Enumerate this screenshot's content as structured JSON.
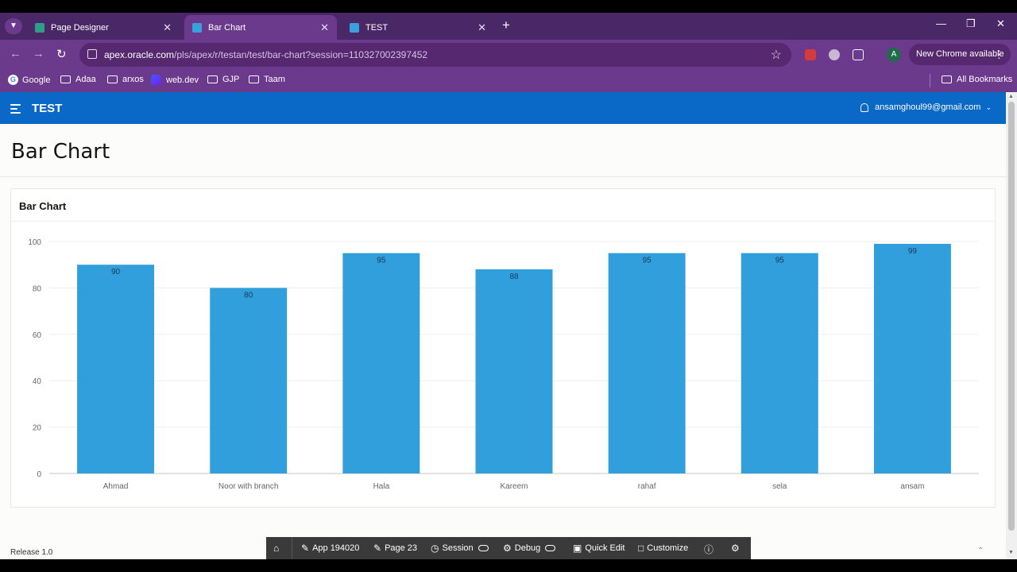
{
  "browser": {
    "tabs": [
      {
        "label": "Page Designer",
        "icon": "apex-designer-icon"
      },
      {
        "label": "Bar Chart",
        "icon": "apex-app-icon",
        "active": true
      },
      {
        "label": "TEST",
        "icon": "apex-app-icon"
      }
    ],
    "url_domain": "apex.oracle.com",
    "url_path": "/pls/apex/r/testan/test/bar-chart?session=110327002397452",
    "profile_initial": "A",
    "new_chrome_label": "New Chrome available",
    "bookmarks": [
      "Google",
      "Adaa",
      "arxos",
      "web.dev",
      "GJP",
      "Taam"
    ],
    "all_bookmarks_label": "All Bookmarks",
    "accent_color": "#6b3a8c"
  },
  "app": {
    "title": "TEST",
    "user": "ansamghoul99@gmail.com",
    "page_title": "Bar Chart",
    "region_title": "Bar Chart",
    "release": "Release 1.0",
    "header_color": "#0a69c7"
  },
  "devbar": {
    "app": "App 194020",
    "page": "Page 23",
    "session": "Session",
    "debug": "Debug",
    "quick_edit": "Quick Edit",
    "customize": "Customize"
  },
  "chart_data": {
    "type": "bar",
    "categories": [
      "Ahmad",
      "Noor with branch",
      "Hala",
      "Kareem",
      "rahaf",
      "sela",
      "ansam"
    ],
    "values": [
      90,
      80,
      95,
      88,
      95,
      95,
      99
    ],
    "ylim": [
      0,
      100
    ],
    "yticks": [
      0,
      20,
      40,
      60,
      80,
      100
    ],
    "grid": true,
    "bar_color": "#309fdb",
    "data_labels": true
  }
}
